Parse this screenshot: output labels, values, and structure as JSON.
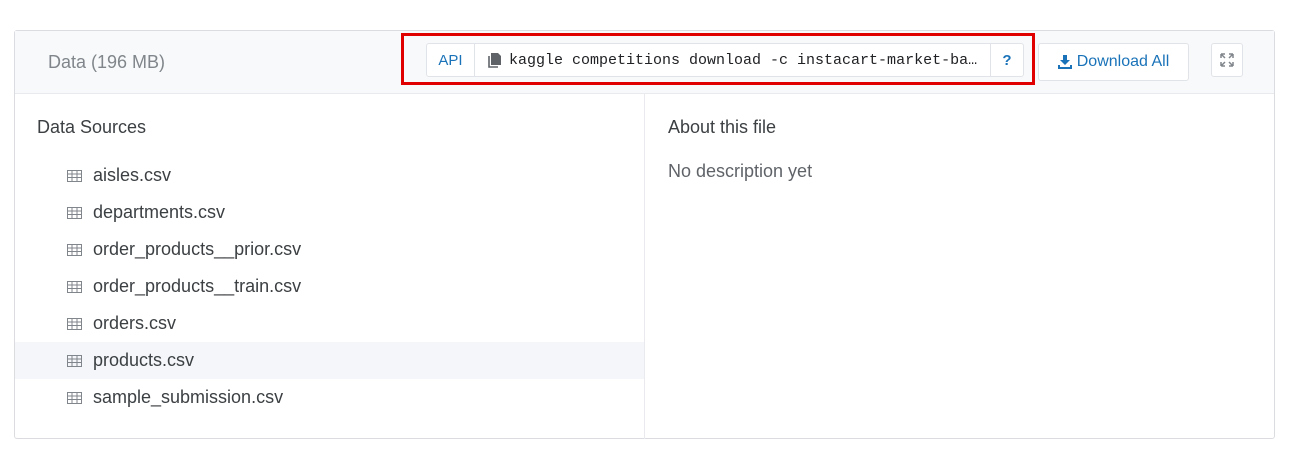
{
  "header": {
    "title": "Data (196 MB)",
    "api_label": "API",
    "api_command": "kaggle competitions download -c instacart-market-basket-analysis",
    "help_label": "?",
    "download_all_label": "Download All"
  },
  "data_sources": {
    "title": "Data Sources",
    "files": [
      {
        "name": "aisles.csv",
        "icon": "table-icon",
        "selected": false
      },
      {
        "name": "departments.csv",
        "icon": "table-icon",
        "selected": false
      },
      {
        "name": "order_products__prior.csv",
        "icon": "table-icon",
        "selected": false
      },
      {
        "name": "order_products__train.csv",
        "icon": "table-icon",
        "selected": false
      },
      {
        "name": "orders.csv",
        "icon": "table-icon",
        "selected": false
      },
      {
        "name": "products.csv",
        "icon": "table-icon",
        "selected": true
      },
      {
        "name": "sample_submission.csv",
        "icon": "table-icon",
        "selected": false
      }
    ]
  },
  "about": {
    "title": "About this file",
    "description": "No description yet"
  },
  "colors": {
    "accent": "#1a73b8",
    "highlight_border": "#e00000",
    "selected_row": "#f4f6f9"
  }
}
